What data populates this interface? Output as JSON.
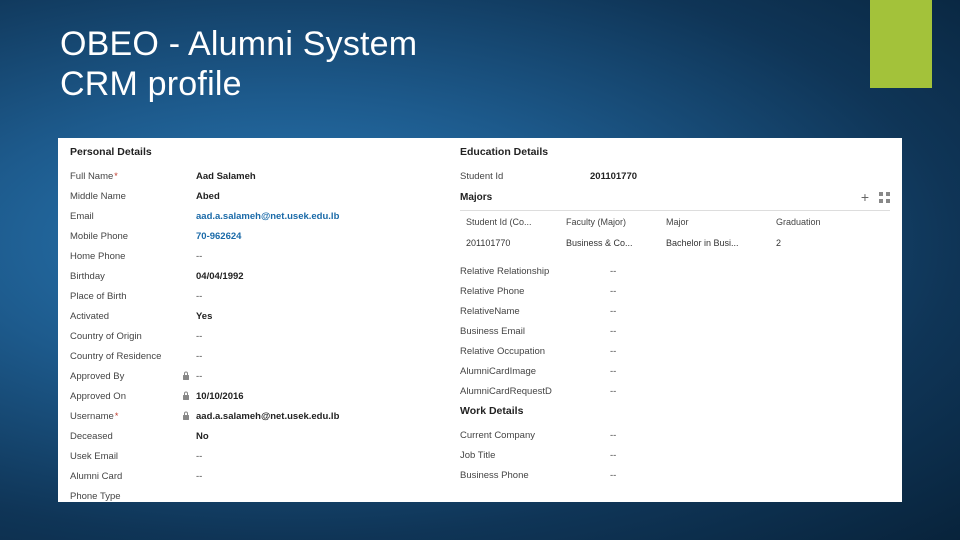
{
  "slide": {
    "title_line1": "OBEO - Alumni  System",
    "title_line2": "CRM profile"
  },
  "sections": {
    "personal_h": "Personal Details",
    "education_h": "Education Details",
    "work_h": "Work Details"
  },
  "personal": {
    "full_name_l": "Full Name",
    "full_name_v": "Aad Salameh",
    "middle_name_l": "Middle Name",
    "middle_name_v": "Abed",
    "email_l": "Email",
    "email_v": "aad.a.salameh@net.usek.edu.lb",
    "mobile_l": "Mobile Phone",
    "mobile_v": "70-962624",
    "home_phone_l": "Home Phone",
    "home_phone_v": "--",
    "birthday_l": "Birthday",
    "birthday_v": "04/04/1992",
    "pob_l": "Place of Birth",
    "pob_v": "--",
    "activated_l": "Activated",
    "activated_v": "Yes",
    "origin_l": "Country of Origin",
    "origin_v": "--",
    "residence_l": "Country of Residence",
    "residence_v": "--",
    "approved_by_l": "Approved By",
    "approved_by_v": "--",
    "approved_on_l": "Approved On",
    "approved_on_v": "10/10/2016",
    "username_l": "Username",
    "username_v": "aad.a.salameh@net.usek.edu.lb",
    "deceased_l": "Deceased",
    "deceased_v": "No",
    "usek_email_l": "Usek Email",
    "usek_email_v": "--",
    "alumni_card_l": "Alumni Card",
    "alumni_card_v": "--",
    "phone_type_l": "Phone Type",
    "phone_type_v": ""
  },
  "education": {
    "student_id_l": "Student Id",
    "student_id_v": "201101770",
    "majors_l": "Majors",
    "table": {
      "head": [
        "Student Id (Co...",
        "Faculty (Major)",
        "Major",
        "Graduation"
      ],
      "row": [
        "201101770",
        "Business & Co...",
        "Bachelor in Busi...",
        "2"
      ]
    },
    "rel_rel_l": "Relative Relationship",
    "rel_rel_v": "--",
    "rel_phone_l": "Relative Phone",
    "rel_phone_v": "--",
    "rel_name_l": "RelativeName",
    "rel_name_v": "--",
    "biz_email_l": "Business Email",
    "biz_email_v": "--",
    "rel_occ_l": "Relative Occupation",
    "rel_occ_v": "--",
    "card_img_l": "AlumniCardImage",
    "card_img_v": "--",
    "card_req_l": "AlumniCardRequestD",
    "card_req_v": "--"
  },
  "work": {
    "company_l": "Current Company",
    "company_v": "--",
    "job_l": "Job Title",
    "job_v": "--",
    "bphone_l": "Business Phone",
    "bphone_v": "--"
  }
}
